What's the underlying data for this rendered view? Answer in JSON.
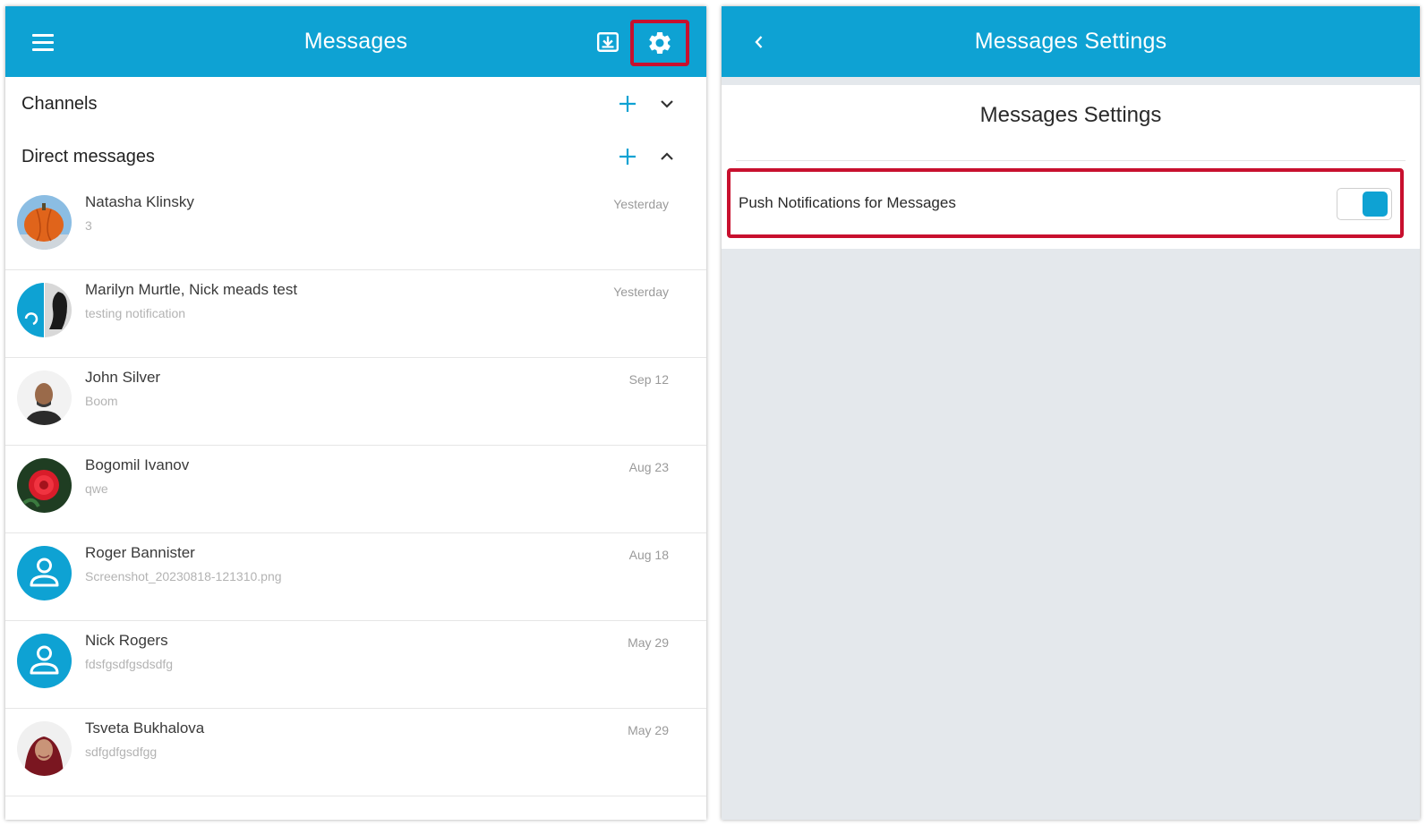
{
  "colors": {
    "accent": "#0ea2d3",
    "highlight": "#c8102e"
  },
  "messages": {
    "title": "Messages",
    "header_icons": [
      "hamburger-menu-icon",
      "download-icon",
      "gear-icon"
    ],
    "channels": {
      "label": "Channels",
      "expanded": false
    },
    "direct": {
      "label": "Direct messages",
      "expanded": true
    },
    "conversations": [
      {
        "name": "Natasha Klinsky",
        "preview": "3",
        "date": "Yesterday",
        "avatar": "pumpkin-photo"
      },
      {
        "name": "Marilyn Murtle, Nick meads test",
        "preview": "testing notification",
        "date": "Yesterday",
        "avatar": "group-photo"
      },
      {
        "name": "John Silver",
        "preview": "Boom",
        "date": "Sep 12",
        "avatar": "person-photo"
      },
      {
        "name": "Bogomil Ivanov",
        "preview": "qwe",
        "date": "Aug 23",
        "avatar": "flower-photo"
      },
      {
        "name": "Roger Bannister",
        "preview": "Screenshot_20230818-121310.png",
        "date": "Aug 18",
        "avatar": "default-user-icon"
      },
      {
        "name": "Nick Rogers",
        "preview": "fdsfgsdfgsdsdfg",
        "date": "May 29",
        "avatar": "default-user-icon"
      },
      {
        "name": "Tsveta Bukhalova",
        "preview": "sdfgdfgsdfgg",
        "date": "May 29",
        "avatar": "person-photo"
      }
    ]
  },
  "settings": {
    "title": "Messages Settings",
    "heading": "Messages Settings",
    "push_label": "Push Notifications for Messages",
    "push_enabled": true
  }
}
